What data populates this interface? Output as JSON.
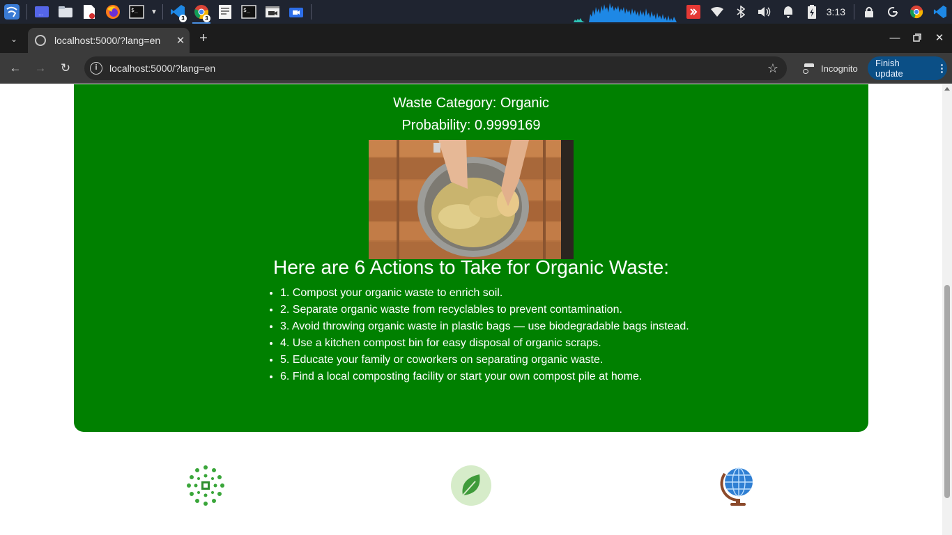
{
  "taskbar": {
    "apps": [
      {
        "name": "kali-menu-icon"
      },
      {
        "name": "workspace-icon"
      },
      {
        "name": "files-icon"
      },
      {
        "name": "text-editor-icon"
      },
      {
        "name": "firefox-icon"
      },
      {
        "name": "terminal-icon"
      },
      {
        "name": "vscode-icon",
        "badge": "3"
      },
      {
        "name": "chrome-icon",
        "badge": "3"
      },
      {
        "name": "document-viewer-icon"
      },
      {
        "name": "terminal-2-icon"
      },
      {
        "name": "video-icon"
      },
      {
        "name": "screen-recorder-icon"
      }
    ],
    "clock": "3:13"
  },
  "browser": {
    "tab_title": "localhost:5000/?lang=en",
    "url": "localhost:5000/?lang=en",
    "incognito_label": "Incognito",
    "finish_update_label": "Finish update"
  },
  "result": {
    "category_line": "Waste Category: Organic",
    "probability_line": "Probability: 0.9999169",
    "heading": "Here are 6 Actions to Take for Organic Waste:",
    "actions": [
      "1. Compost your organic waste to enrich soil.",
      "2. Separate organic waste from recyclables to prevent contamination.",
      "3. Avoid throwing organic waste in plastic bags — use biodegradable bags instead.",
      "4. Use a kitchen compost bin for easy disposal of organic scraps.",
      "5. Educate your family or coworkers on separating organic waste.",
      "6. Find a local composting facility or start your own compost pile at home."
    ]
  },
  "colors": {
    "card_green": "#008000",
    "taskbar_bg": "#1f2430",
    "update_button": "#0b4f86"
  },
  "footer_icons": [
    "recycling-circle-icon",
    "leaf-icon",
    "globe-icon"
  ]
}
